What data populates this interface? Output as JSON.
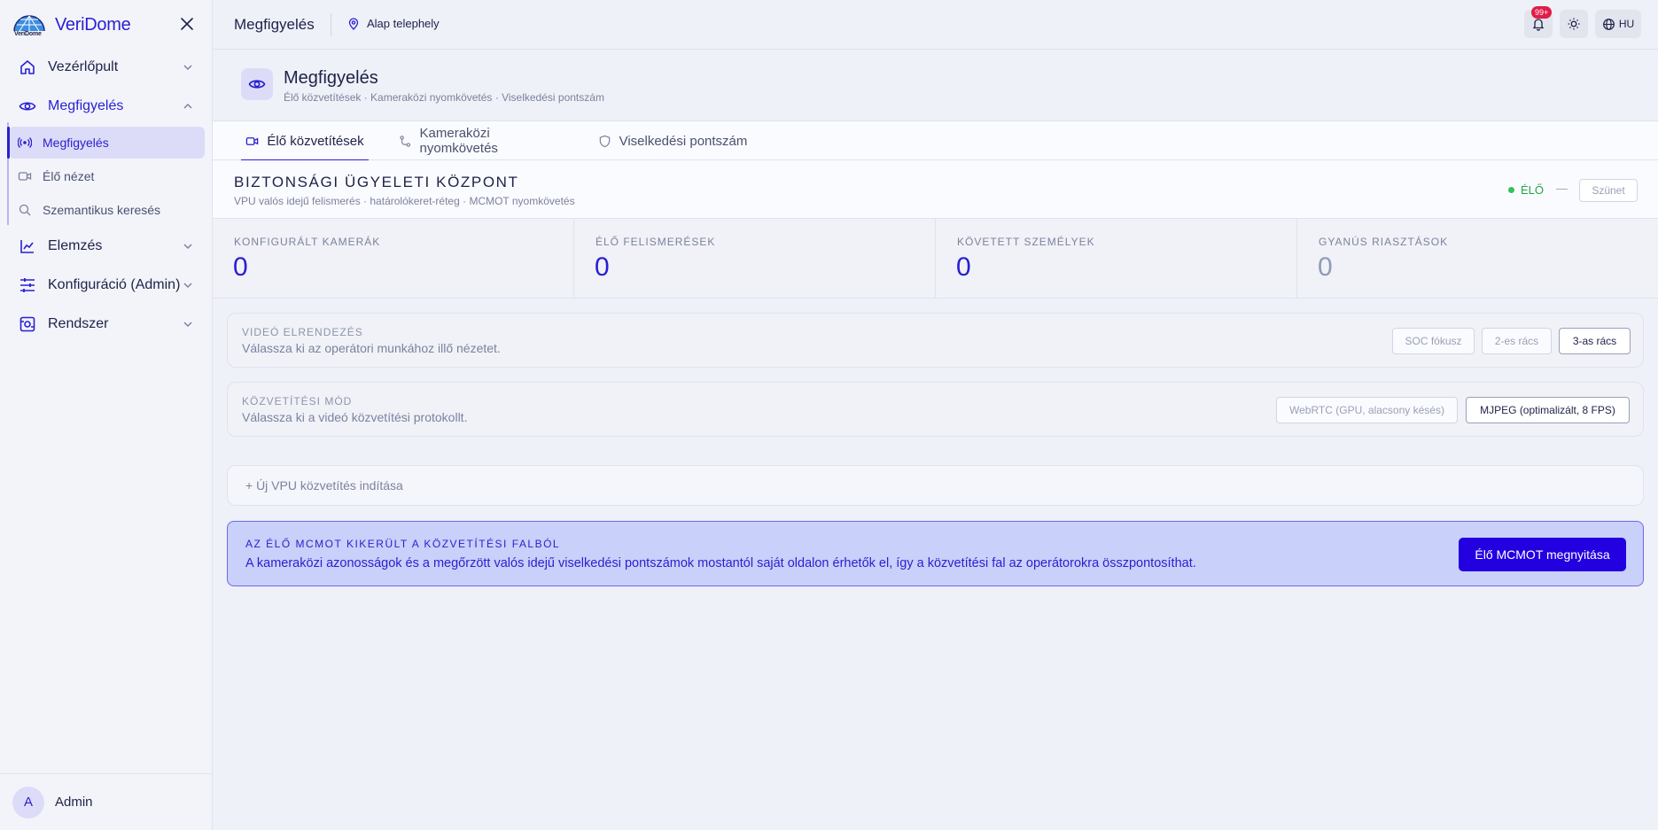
{
  "app": {
    "name": "VeriDome",
    "logo_text": "VeriDome"
  },
  "sidebar": {
    "groups": [
      {
        "label": "Vezérlőpult"
      },
      {
        "label": "Megfigyelés"
      },
      {
        "label": "Elemzés"
      },
      {
        "label": "Konfiguráció (Admin)"
      },
      {
        "label": "Rendszer"
      }
    ],
    "sub_items": [
      {
        "label": "Megfigyelés"
      },
      {
        "label": "Élő nézet"
      },
      {
        "label": "Szemantikus keresés"
      }
    ],
    "user": {
      "initial": "A",
      "name": "Admin"
    }
  },
  "topbar": {
    "title": "Megfigyelés",
    "site": "Alap telephely",
    "notification_badge": "99+",
    "language": "HU"
  },
  "page": {
    "title": "Megfigyelés",
    "subtitle": "Élő közvetítések · Kameraközi nyomkövetés · Viselkedési pontszám"
  },
  "tabs": [
    {
      "label": "Élő közvetítések",
      "active": true
    },
    {
      "label": "Kameraközi nyomkövetés",
      "active": false
    },
    {
      "label": "Viselkedési pontszám",
      "active": false
    }
  ],
  "ops": {
    "title": "BIZTONSÁGI ÜGYELETI KÖZPONT",
    "subtitle": "VPU valós idejű felismerés · határolókeret-réteg · MCMOT nyomkövetés",
    "live_label": "ÉLŐ",
    "dash": "—",
    "pause_label": "Szünet"
  },
  "stats": [
    {
      "label": "KONFIGURÁLT KAMERÁK",
      "value": "0"
    },
    {
      "label": "ÉLŐ FELISMERÉSEK",
      "value": "0"
    },
    {
      "label": "KÖVETETT SZEMÉLYEK",
      "value": "0"
    },
    {
      "label": "GYANÚS RIASZTÁSOK",
      "value": "0"
    }
  ],
  "layout_panel": {
    "label": "VIDEÓ ELRENDEZÉS",
    "description": "Válassza ki az operátori munkához illő nézetet.",
    "options": [
      "SOC fókusz",
      "2-es rács",
      "3-as rács"
    ],
    "selected": "3-as rács"
  },
  "stream_panel": {
    "label": "KÖZVETÍTÉSI MÓD",
    "description": "Válassza ki a videó közvetítési protokollt.",
    "options": [
      "WebRTC (GPU, alacsony késés)",
      "MJPEG (optimalizált, 8 FPS)"
    ],
    "selected": "MJPEG (optimalizált, 8 FPS)"
  },
  "new_stream_label": "+ Új VPU közvetítés indítása",
  "notice": {
    "title": "AZ ÉLŐ MCMOT KIKERÜLT A KÖZVETÍTÉSI FALBÓL",
    "text": "A kameraközi azonosságok és a megőrzött valós idejű viselkedési pontszámok mostantól saját oldalon érhetők el, így a közvetítési fal az operátorokra összpontosíthat.",
    "button": "Élő MCMOT megnyitása"
  },
  "colors": {
    "accent": "#2a1fd1",
    "live": "#34c25a",
    "badge": "#e11d48",
    "notice_bg": "#c9d0f9"
  }
}
